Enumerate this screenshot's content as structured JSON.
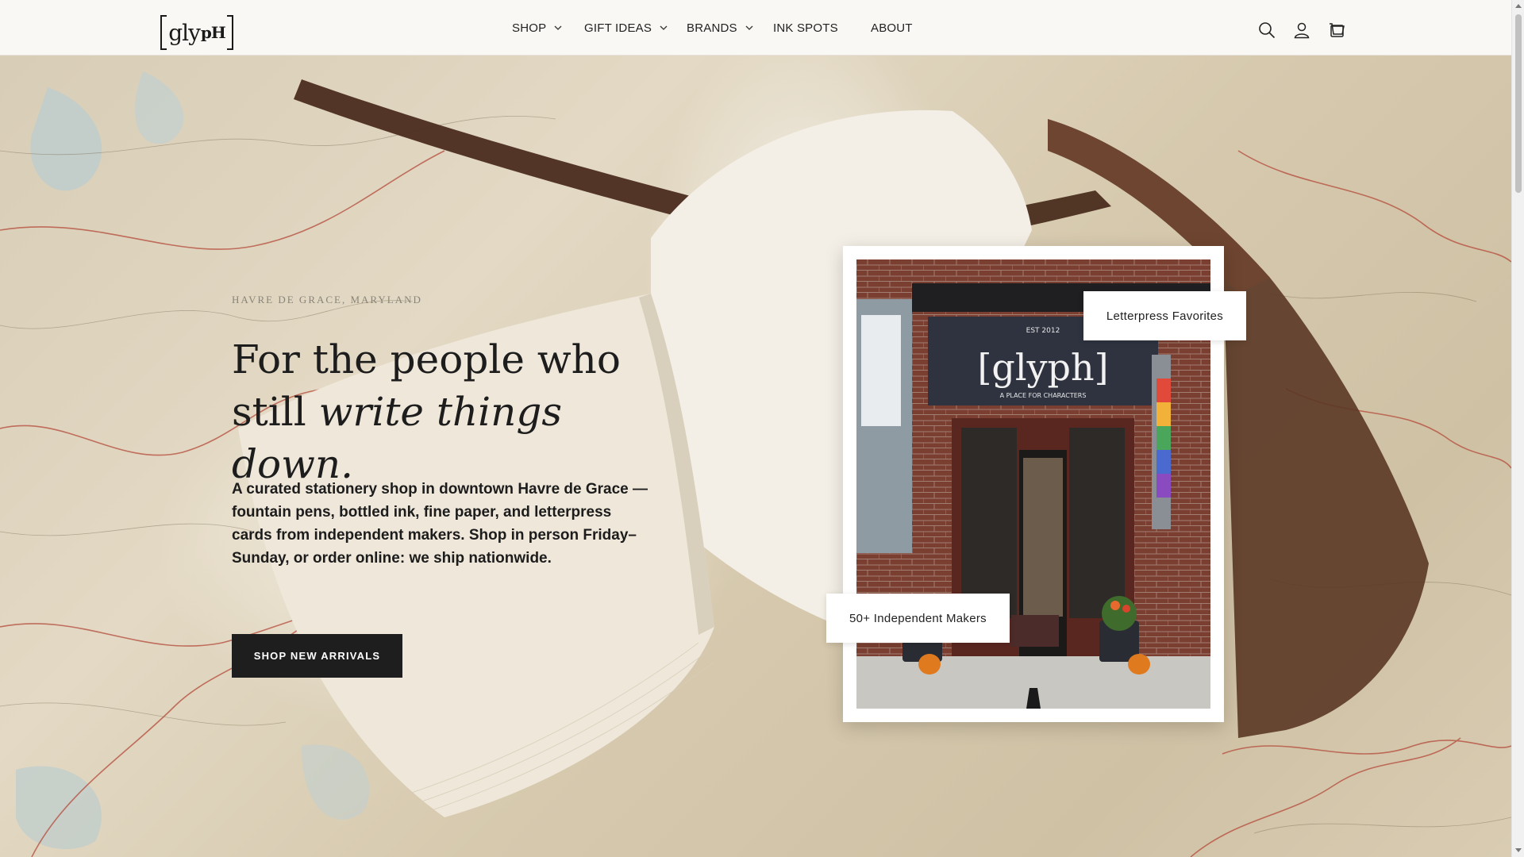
{
  "brand": {
    "logo_text": "[glyph]",
    "logo_main": "gly",
    "logo_ph": "pH"
  },
  "nav": {
    "items": [
      {
        "label": "SHOP",
        "has_dropdown": true
      },
      {
        "label": "GIFT IDEAS",
        "has_dropdown": true
      },
      {
        "label": "BRANDS",
        "has_dropdown": true
      },
      {
        "label": "INK SPOTS",
        "has_dropdown": false
      },
      {
        "label": "ABOUT",
        "has_dropdown": false
      }
    ]
  },
  "header_icons": [
    "search-icon",
    "account-icon",
    "cart-icon"
  ],
  "hero": {
    "eyebrow": "HAVRE DE GRACE, MARYLAND",
    "headline_line1": "For the people who",
    "headline_line2_plain": "still ",
    "headline_line2_italic": "write things down.",
    "lede": "A curated stationery shop in downtown Havre de Grace — fountain pens, bottled ink, fine paper, and letterpress cards from independent makers. Shop in person Friday–Sunday, or order online: we ship nationwide.",
    "cta_label": "SHOP NEW ARRIVALS",
    "tag_top": "Letterpress Favorites",
    "tag_bottom": "50+ Independent Makers",
    "storefront_sign": "[glyph]",
    "storefront_est": "EST 2012",
    "storefront_tagline": "A PLACE FOR CHARACTERS"
  },
  "colors": {
    "header_bg": "#faf8f4",
    "cta_bg": "#1e1e1e",
    "text": "#1d1d1d",
    "brick": "#6b3b2e",
    "sign_bg": "#2f3340"
  }
}
